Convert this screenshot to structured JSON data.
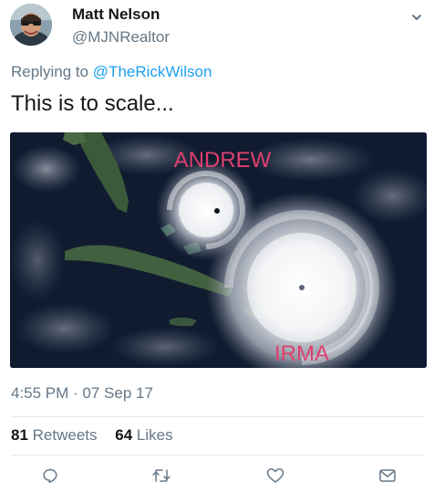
{
  "tweet": {
    "display_name": "Matt Nelson",
    "handle": "@MJNRealtor",
    "reply_prefix": "Replying to",
    "reply_handle": "@TheRickWilson",
    "text": "This is to scale...",
    "media": {
      "label_top": "ANDREW",
      "label_bottom": "IRMA",
      "label_color": "#e0406e"
    },
    "timestamp": "4:55 PM · 07 Sep 17",
    "stats": {
      "retweets_count": "81",
      "retweets_label": "Retweets",
      "likes_count": "64",
      "likes_label": "Likes"
    },
    "actions": [
      {
        "icon": "reply-icon"
      },
      {
        "icon": "retweet-icon"
      },
      {
        "icon": "like-icon"
      },
      {
        "icon": "message-icon"
      }
    ],
    "colors": {
      "link": "#1da1f2",
      "secondary_text": "#657786",
      "primary_text": "#14171a",
      "divider": "#e1e8ed"
    }
  }
}
